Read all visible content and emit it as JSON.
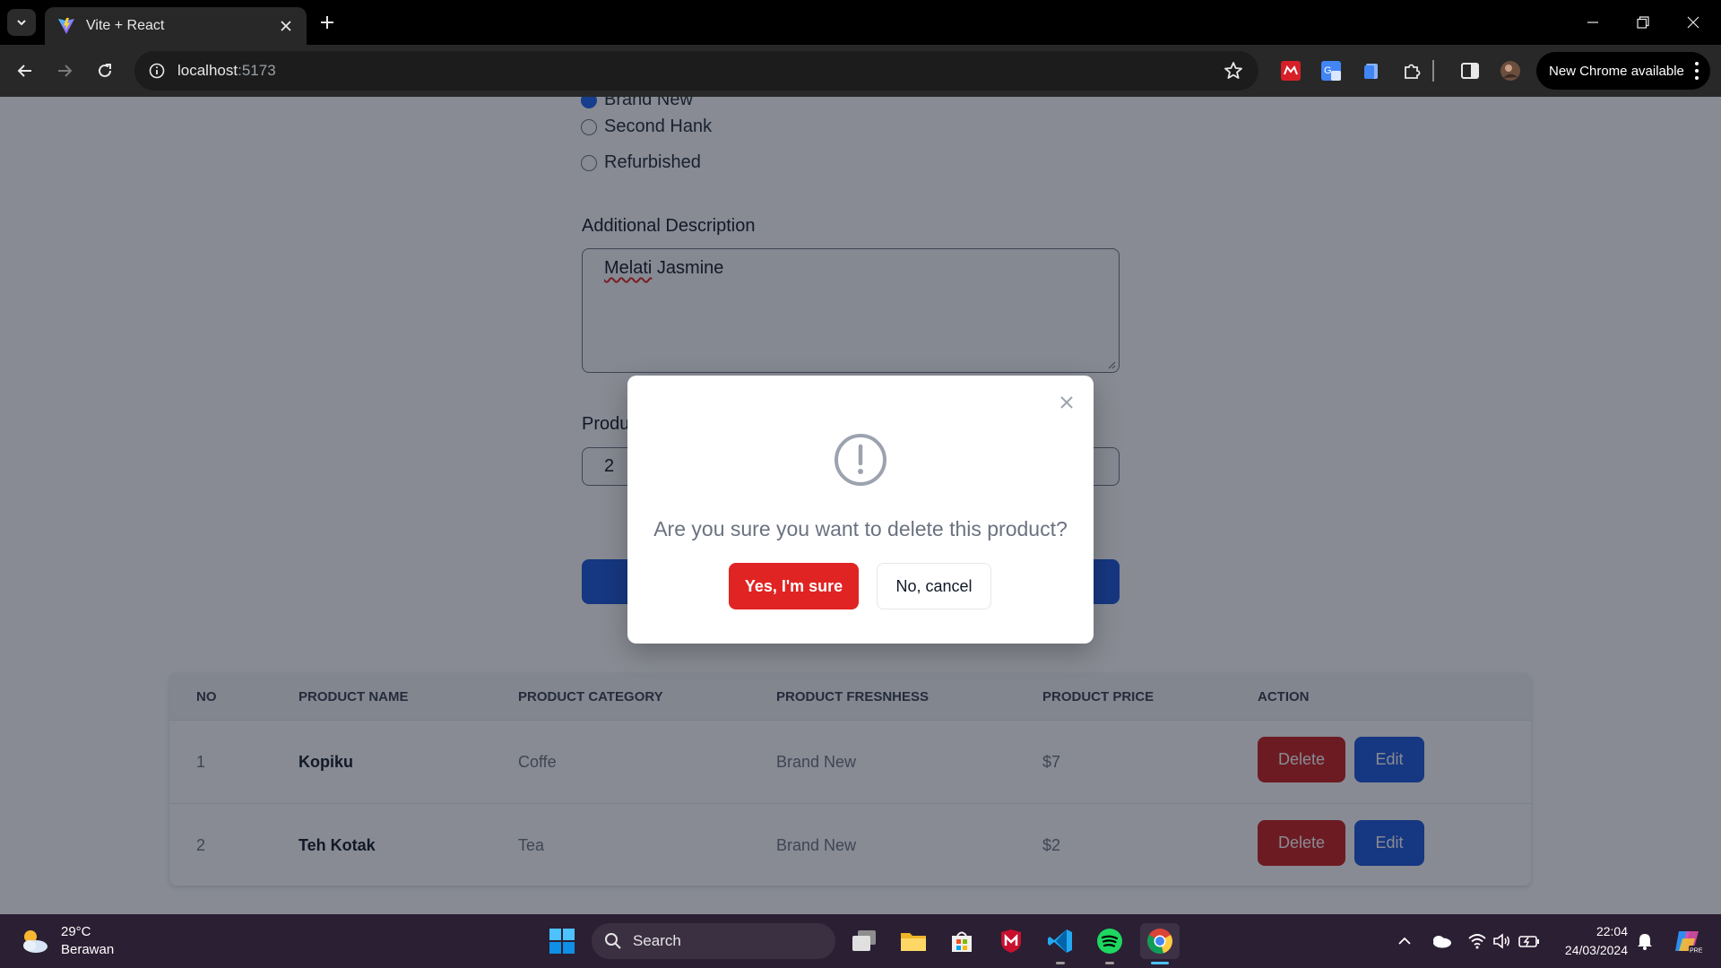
{
  "browser": {
    "tab_title": "Vite + React",
    "url_host": "localhost",
    "url_port": ":5173",
    "update_label": "New Chrome available"
  },
  "form": {
    "freshness_options": [
      {
        "label": "Brand New",
        "checked": true
      },
      {
        "label": "Second Hank",
        "checked": false
      },
      {
        "label": "Refurbished",
        "checked": false
      }
    ],
    "description_label": "Additional Description",
    "description_value_part1": "Melati",
    "description_value_part2": " Jasmine",
    "price_label": "Product Price",
    "price_value": "2"
  },
  "table": {
    "headers": [
      "NO",
      "PRODUCT NAME",
      "PRODUCT CATEGORY",
      "PRODUCT FRESNHESS",
      "PRODUCT PRICE",
      "ACTION"
    ],
    "rows": [
      {
        "no": "1",
        "name": "Kopiku",
        "category": "Coffe",
        "freshness": "Brand New",
        "price": "$7",
        "delete": "Delete",
        "edit": "Edit"
      },
      {
        "no": "2",
        "name": "Teh Kotak",
        "category": "Tea",
        "freshness": "Brand New",
        "price": "$2",
        "delete": "Delete",
        "edit": "Edit"
      }
    ]
  },
  "modal": {
    "message": "Are you sure you want to delete this product?",
    "confirm_label": "Yes, I'm sure",
    "cancel_label": "No, cancel"
  },
  "taskbar": {
    "temperature": "29°C",
    "weather": "Berawan",
    "search_label": "Search",
    "time": "22:04",
    "date": "24/03/2024"
  },
  "colors": {
    "primary": "#1a56db",
    "danger": "#e02424",
    "delete_btn": "#c81e1e"
  }
}
